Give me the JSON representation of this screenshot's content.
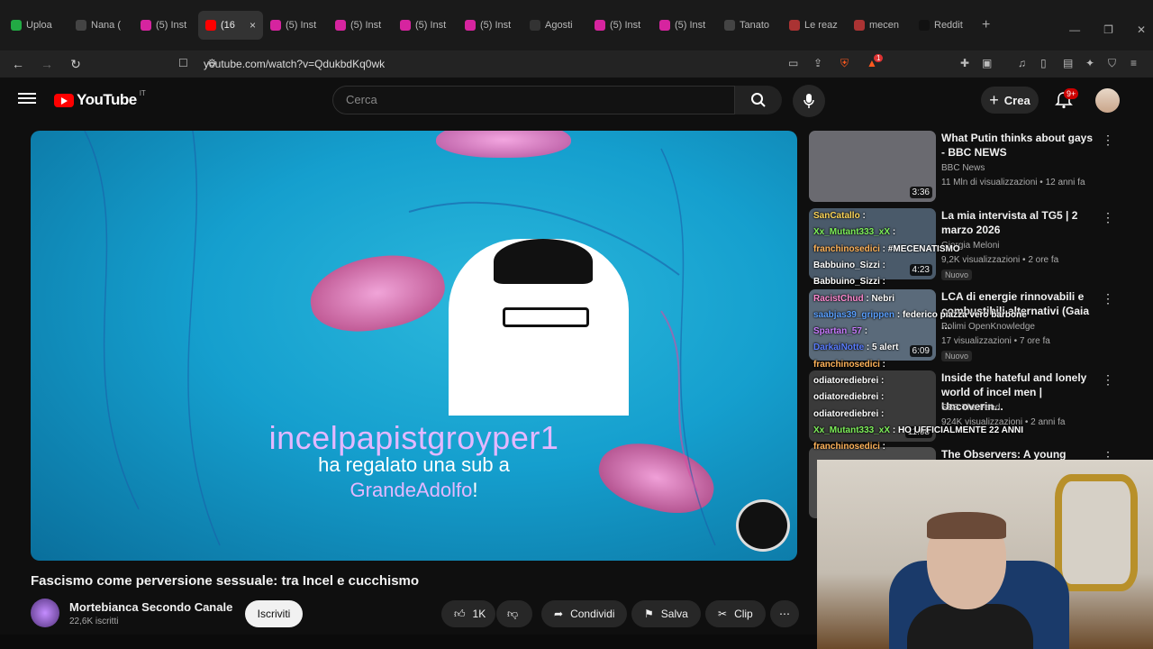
{
  "browser": {
    "tabs": [
      {
        "label": "Uploa",
        "fav": "play-icon",
        "color": "#22aa44"
      },
      {
        "label": "Nana (",
        "fav": "W",
        "color": "#444444"
      },
      {
        "label": "(5) Inst",
        "fav": "instagram",
        "color": "#d6249f"
      },
      {
        "label": "(16",
        "fav": "youtube",
        "color": "#ff0000",
        "active": true
      },
      {
        "label": "(5) Inst",
        "fav": "instagram",
        "color": "#d6249f"
      },
      {
        "label": "(5) Inst",
        "fav": "instagram",
        "color": "#d6249f"
      },
      {
        "label": "(5) Inst",
        "fav": "instagram",
        "color": "#d6249f"
      },
      {
        "label": "(5) Inst",
        "fav": "instagram",
        "color": "#d6249f"
      },
      {
        "label": "Agosti",
        "fav": "github",
        "color": "#333333"
      },
      {
        "label": "(5) Inst",
        "fav": "instagram",
        "color": "#d6249f"
      },
      {
        "label": "(5) Inst",
        "fav": "instagram",
        "color": "#d6249f"
      },
      {
        "label": "Tanato",
        "fav": "W",
        "color": "#444444"
      },
      {
        "label": "Le reaz",
        "fav": "web",
        "color": "#aa3333"
      },
      {
        "label": "mecen",
        "fav": "web",
        "color": "#aa3333"
      },
      {
        "label": "Reddit",
        "fav": "X",
        "color": "#111111"
      }
    ],
    "tab_close": "×",
    "tab_new": "+",
    "url": "youtube.com/watch?v=QdukbdKq0wk",
    "extension_badge": "1"
  },
  "youtube": {
    "logo_text": "YouTube",
    "logo_country": "IT",
    "search_placeholder": "Cerca",
    "create_label": "Crea",
    "notif_badge": "9+"
  },
  "video": {
    "overlay_user": "incelpapistgroyper1",
    "overlay_line": "ha regalato una sub a",
    "overlay_target": "GrandeAdolfo",
    "overlay_target_suffix": "!",
    "title": "Fascismo come perversione sessuale: tra Incel e cucchismo",
    "channel": "Mortebianca Secondo Canale",
    "subscribers": "22,6K iscritti",
    "subscribe_label": "Iscriviti",
    "likes": "1K",
    "share_label": "Condividi",
    "save_label": "Salva",
    "clip_label": "Clip"
  },
  "sidebar": [
    {
      "title": "What Putin thinks about gays - BBC NEWS",
      "channel": "BBC News",
      "meta": "11 Mln di visualizzazioni • 12 anni fa",
      "duration": "3:36",
      "thumb": "#6a6a70"
    },
    {
      "title": "La mia intervista al TG5 | 2 marzo 2026",
      "channel": "Giorgia Meloni",
      "meta": "9,2K visualizzazioni • 2 ore fa",
      "duration": "4:23",
      "new": "Nuovo",
      "thumb": "#4a5a6a"
    },
    {
      "title": "LCA di energie rinnovabili e combustibili alternativi (Gaia ...",
      "channel": "Polimi OpenKnowledge",
      "meta": "17 visualizzazioni • 7 ore fa",
      "duration": "6:09",
      "new": "Nuovo",
      "thumb": "#5a6a7a"
    },
    {
      "title": "Inside the hateful and lonely world of incel men | Uncoverin...",
      "channel": "SBS The Feed",
      "meta": "924K visualizzazioni • 2 anni fa",
      "duration": "11:08",
      "thumb": "#3a3a3a"
    },
    {
      "title": "The Observers: A young Afghan",
      "channel": "",
      "meta": "",
      "duration": "",
      "thumb": "#4a4a4a"
    }
  ],
  "chat": [
    {
      "user": "SanCatallo",
      "msg": "",
      "color": "#ffd75a"
    },
    {
      "user": "Xx_Mutant333_xX",
      "msg": "",
      "color": "#7ef05a"
    },
    {
      "user": "franchinosedici",
      "msg": "#MECENATISMO",
      "color": "#ffb35a"
    },
    {
      "user": "Babbuino_Sizzi",
      "msg": "",
      "color": "#ffffff"
    },
    {
      "user": "Babbuino_Sizzi",
      "msg": "",
      "color": "#ffffff"
    },
    {
      "user": "RacistChud",
      "msg": "Nebri",
      "color": "#ff8ad0"
    },
    {
      "user": "saabjas39_grippen",
      "msg": "federico piazza vero barbone",
      "color": "#5aa0ff"
    },
    {
      "user": "Spartan_57",
      "msg": "",
      "color": "#c87bff"
    },
    {
      "user": "DarkaiNotte",
      "msg": "5 alert",
      "color": "#5a7dff"
    },
    {
      "user": "franchinosedici",
      "msg": "",
      "color": "#ffb35a"
    },
    {
      "user": "odiatorediebrei",
      "msg": "",
      "color": "#ffffff"
    },
    {
      "user": "odiatorediebrei",
      "msg": "",
      "color": "#ffffff"
    },
    {
      "user": "odiatorediebrei",
      "msg": "",
      "color": "#ffffff"
    },
    {
      "user": "Xx_Mutant333_xX",
      "msg": "HO UFFICIALMENTE 22 ANNI",
      "color": "#7ef05a"
    },
    {
      "user": "franchinosedici",
      "msg": "",
      "color": "#ffb35a"
    }
  ]
}
